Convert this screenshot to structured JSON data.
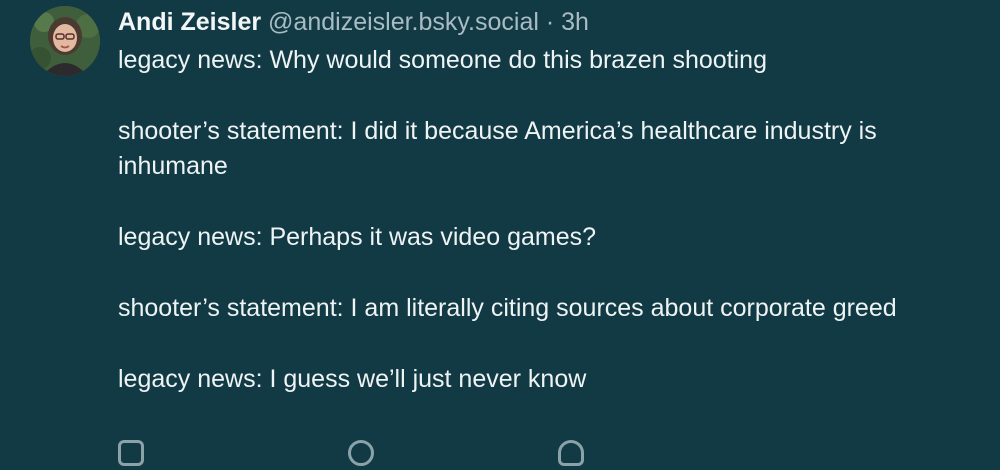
{
  "post": {
    "author": {
      "name": "Andi Zeisler",
      "handle": "@andizeisler.bsky.social",
      "avatar_icon": "profile-photo-icon"
    },
    "separator": "·",
    "time": "3h",
    "paragraphs": [
      "legacy news: Why would someone do this brazen shooting",
      "shooter’s statement: I did it because America’s healthcare industry is inhumane",
      "legacy news: Perhaps it was video games?",
      "shooter’s statement: I am literally citing sources about corporate greed",
      "legacy news: I guess we’ll just never know"
    ]
  },
  "actions": [
    {
      "icon": "reply-icon"
    },
    {
      "icon": "repost-icon"
    },
    {
      "icon": "like-icon"
    }
  ],
  "colors": {
    "background": "#123a44",
    "text": "#eef3f4",
    "muted": "#a8bcc2"
  }
}
